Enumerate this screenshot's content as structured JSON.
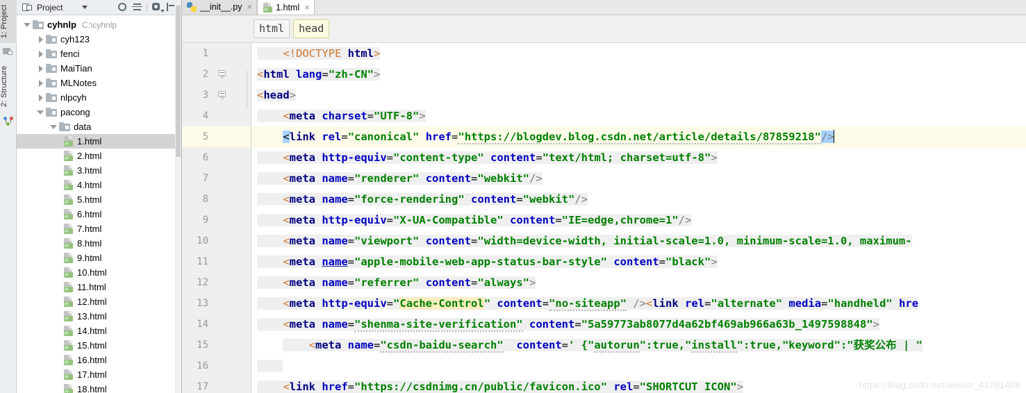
{
  "toolstrip": {
    "tabs": [
      {
        "label": "1: Project",
        "selected": true
      },
      {
        "label": "2: Structure",
        "selected": false
      }
    ]
  },
  "project_panel": {
    "header": {
      "title": "Project",
      "icon": "project-icon",
      "dropdown_icon": "chevron-down-icon",
      "buttons": [
        {
          "name": "locate-target-button",
          "icon": "target-icon"
        },
        {
          "name": "collapse-all-button",
          "icon": "collapse-all-icon"
        },
        {
          "name": "settings-button",
          "icon": "gear-icon"
        },
        {
          "name": "hide-panel-button",
          "icon": "hide-panel-icon"
        }
      ]
    },
    "tree": [
      {
        "label": "cyhnlp",
        "path": "C:\\cyhnlp",
        "type": "root",
        "indent": 0,
        "expanded": true,
        "bold": true
      },
      {
        "label": "cyh123",
        "type": "folder",
        "indent": 1,
        "expanded": false
      },
      {
        "label": "fenci",
        "type": "folder",
        "indent": 1,
        "expanded": false
      },
      {
        "label": "MaiTian",
        "type": "folder",
        "indent": 1,
        "expanded": false
      },
      {
        "label": "MLNotes",
        "type": "folder",
        "indent": 1,
        "expanded": false
      },
      {
        "label": "nlpcyh",
        "type": "folder",
        "indent": 1,
        "expanded": false
      },
      {
        "label": "pacong",
        "type": "folder",
        "indent": 1,
        "expanded": true
      },
      {
        "label": "data",
        "type": "folder",
        "indent": 2,
        "expanded": true
      },
      {
        "label": "1.html",
        "type": "html-file",
        "indent": 3,
        "selected": true
      },
      {
        "label": "2.html",
        "type": "html-file",
        "indent": 3
      },
      {
        "label": "3.html",
        "type": "html-file",
        "indent": 3
      },
      {
        "label": "4.html",
        "type": "html-file",
        "indent": 3
      },
      {
        "label": "5.html",
        "type": "html-file",
        "indent": 3
      },
      {
        "label": "6.html",
        "type": "html-file",
        "indent": 3
      },
      {
        "label": "7.html",
        "type": "html-file",
        "indent": 3
      },
      {
        "label": "8.html",
        "type": "html-file",
        "indent": 3
      },
      {
        "label": "9.html",
        "type": "html-file",
        "indent": 3
      },
      {
        "label": "10.html",
        "type": "html-file",
        "indent": 3
      },
      {
        "label": "11.html",
        "type": "html-file",
        "indent": 3
      },
      {
        "label": "12.html",
        "type": "html-file",
        "indent": 3
      },
      {
        "label": "13.html",
        "type": "html-file",
        "indent": 3
      },
      {
        "label": "14.html",
        "type": "html-file",
        "indent": 3
      },
      {
        "label": "15.html",
        "type": "html-file",
        "indent": 3
      },
      {
        "label": "16.html",
        "type": "html-file",
        "indent": 3
      },
      {
        "label": "17.html",
        "type": "html-file",
        "indent": 3
      },
      {
        "label": "18.html",
        "type": "html-file",
        "indent": 3
      }
    ]
  },
  "editor": {
    "tabs": [
      {
        "label": "__init__.py",
        "icon": "python-file-icon",
        "active": false,
        "close": "×"
      },
      {
        "label": "1.html",
        "icon": "html-file-icon",
        "active": true,
        "close": "×"
      }
    ],
    "breadcrumbs": [
      {
        "label": "html",
        "highlighted": false
      },
      {
        "label": "head",
        "highlighted": true
      }
    ],
    "current_line": 5,
    "line_numbers": [
      "1",
      "2",
      "3",
      "4",
      "5",
      "6",
      "7",
      "8",
      "9",
      "10",
      "11",
      "12",
      "13",
      "14",
      "15",
      "16",
      "17"
    ],
    "lines": [
      {
        "n": 1,
        "text": "    <!DOCTYPE html>"
      },
      {
        "n": 2,
        "text": "<html lang=\"zh-CN\">",
        "fold": true
      },
      {
        "n": 3,
        "text": "<head>",
        "fold": true
      },
      {
        "n": 4,
        "text": "    <meta charset=\"UTF-8\">"
      },
      {
        "n": 5,
        "text": "    <link rel=\"canonical\" href=\"https://blogdev.blog.csdn.net/article/details/87859218\"/>",
        "current": true
      },
      {
        "n": 6,
        "text": "    <meta http-equiv=\"content-type\" content=\"text/html; charset=utf-8\">"
      },
      {
        "n": 7,
        "text": "    <meta name=\"renderer\" content=\"webkit\"/>"
      },
      {
        "n": 8,
        "text": "    <meta name=\"force-rendering\" content=\"webkit\"/>"
      },
      {
        "n": 9,
        "text": "    <meta http-equiv=\"X-UA-Compatible\" content=\"IE=edge,chrome=1\"/>"
      },
      {
        "n": 10,
        "text": "    <meta name=\"viewport\" content=\"width=device-width, initial-scale=1.0, minimum-scale=1.0, maximum-"
      },
      {
        "n": 11,
        "text": "    <meta name=\"apple-mobile-web-app-status-bar-style\" content=\"black\">"
      },
      {
        "n": 12,
        "text": "    <meta name=\"referrer\" content=\"always\">"
      },
      {
        "n": 13,
        "text": "    <meta http-equiv=\"Cache-Control\" content=\"no-siteapp\" /><link rel=\"alternate\" media=\"handheld\" hre"
      },
      {
        "n": 14,
        "text": "    <meta name=\"shenma-site-verification\" content=\"5a59773ab8077d4a62bf469ab966a63b_1497598848\">"
      },
      {
        "n": 15,
        "text": "        <meta name=\"csdn-baidu-search\"  content=' {\"autorun\":true,\"install\":true,\"keyword\":\"获奖公布 | \""
      },
      {
        "n": 16,
        "text": ""
      },
      {
        "n": 17,
        "text": "    <link href=\"https://csdnimg.cn/public/favicon.ico\" rel=\"SHORTCUT ICON\">"
      }
    ]
  },
  "watermark": "https://blog.csdn.net/weixin_41781408",
  "colors": {
    "tag": "#000080",
    "attribute": "#0000c0",
    "value": "#008000",
    "bracket": "#cc7832",
    "current_line_bg": "#fdfbe8",
    "selection": "#a6d2ff",
    "token_highlight": "#faedc0",
    "panel_bg": "#eceff1",
    "tree_selected": "#d4d4d4"
  }
}
